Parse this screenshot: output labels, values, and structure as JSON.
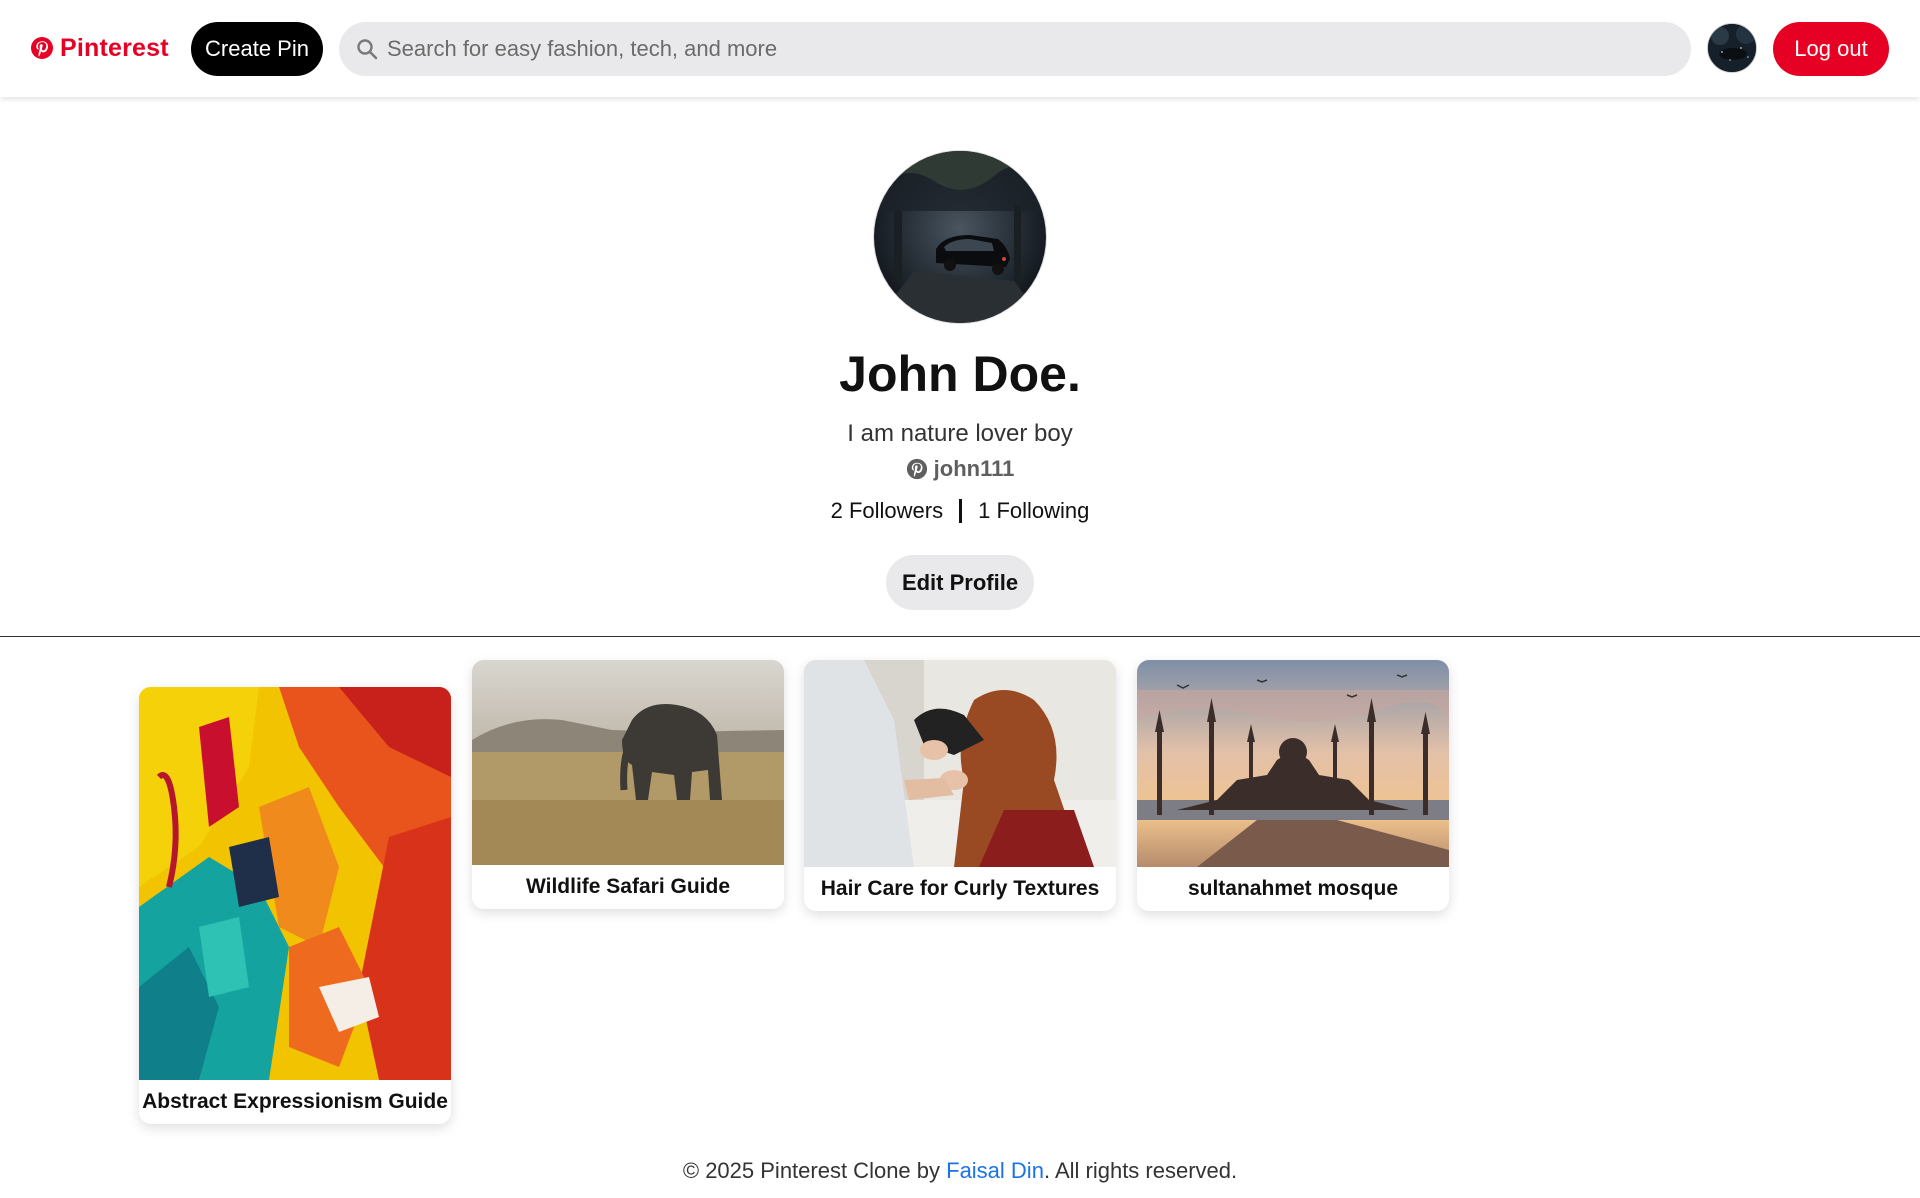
{
  "nav": {
    "brand": "Pinterest",
    "create_pin": "Create Pin",
    "search_placeholder": "Search for easy fashion, tech, and more",
    "logout": "Log out"
  },
  "profile": {
    "name": "John Doe.",
    "bio": "I am nature lover boy",
    "handle": "john111",
    "followers": "2 Followers",
    "following": "1 Following",
    "edit": "Edit Profile"
  },
  "pins": [
    {
      "title": "Abstract Expressionism Guide"
    },
    {
      "title": "Wildlife Safari Guide"
    },
    {
      "title": "Hair Care for Curly Textures"
    },
    {
      "title": "sultanahmet mosque"
    }
  ],
  "footer": {
    "prefix": "© 2025 Pinterest Clone by ",
    "author": "Faisal Din",
    "suffix": ". All rights reserved."
  },
  "colors": {
    "brand_red": "#e60023",
    "link_blue": "#1a73e8",
    "search_bg": "#e9e9eb"
  },
  "icons": {
    "brand": "pinterest-logo-icon",
    "search": "search-icon",
    "handle": "pinterest-small-icon"
  }
}
